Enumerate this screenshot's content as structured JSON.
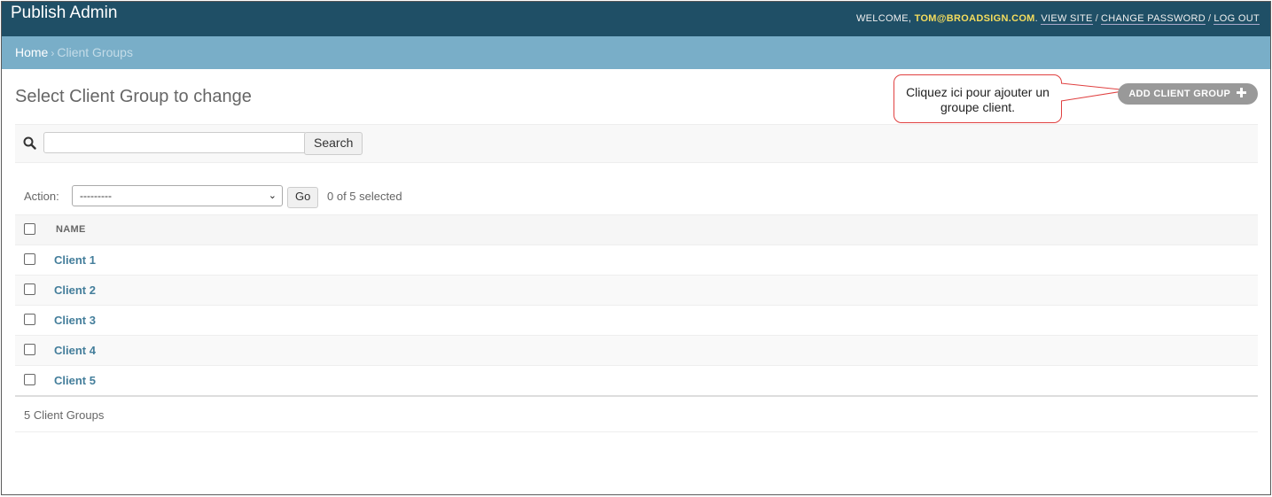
{
  "header": {
    "brand": "Publish Admin",
    "welcome": "Welcome,",
    "user": "tom@broadsign.com",
    "view_site": "View site",
    "change_password": "Change password",
    "log_out": "Log out"
  },
  "breadcrumbs": {
    "home": "Home",
    "current": "Client Groups"
  },
  "page": {
    "title": "Select Client Group to change",
    "add_button": "Add Client Group",
    "callout": "Cliquez ici pour ajouter un groupe client."
  },
  "search": {
    "value": "",
    "button": "Search"
  },
  "actions": {
    "label": "Action:",
    "selected_option": "---------",
    "go_button": "Go",
    "selected_count": "0 of 5 selected"
  },
  "table": {
    "column_name": "Name",
    "rows": [
      "Client 1",
      "Client 2",
      "Client 3",
      "Client 4",
      "Client 5"
    ]
  },
  "paginator": {
    "text": "5 Client Groups"
  },
  "colors": {
    "header_bg": "#1f4f66",
    "breadcrumb_bg": "#79aec8",
    "link": "#447e9b",
    "user_highlight": "#f5dd5d",
    "callout_border": "#e04040"
  }
}
